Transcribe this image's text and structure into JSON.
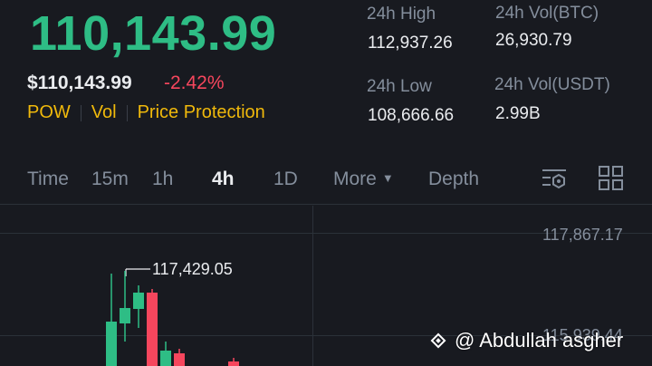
{
  "ticker": {
    "last_price": "110,143.99",
    "usd_price": "$110,143.99",
    "change_pct": "-2.42%"
  },
  "tags": [
    "POW",
    "Vol",
    "Price Protection"
  ],
  "stats": {
    "high_label": "24h High",
    "high_value": "112,937.26",
    "low_label": "24h Low",
    "low_value": "108,666.66",
    "vol_btc_label": "24h Vol(BTC)",
    "vol_btc_value": "26,930.79",
    "vol_usdt_label": "24h Vol(USDT)",
    "vol_usdt_value": "2.99B"
  },
  "timeframes": {
    "time": "Time",
    "m15": "15m",
    "h1": "1h",
    "h4": "4h",
    "d1": "1D",
    "more": "More",
    "depth": "Depth",
    "active": "4h"
  },
  "chart": {
    "axis_top": "117,867.17",
    "axis_mid": "115,939.44",
    "high_marker": "117,429.05"
  },
  "watermark": "@ Abdullah asgher",
  "colors": {
    "up": "#2ebd85",
    "down": "#f6465d",
    "accent": "#f0b90b",
    "bg": "#181a20"
  },
  "icons": [
    "settings-indicator-icon",
    "layout-grid-icon",
    "chevron-down-icon",
    "binance-logo-icon"
  ]
}
